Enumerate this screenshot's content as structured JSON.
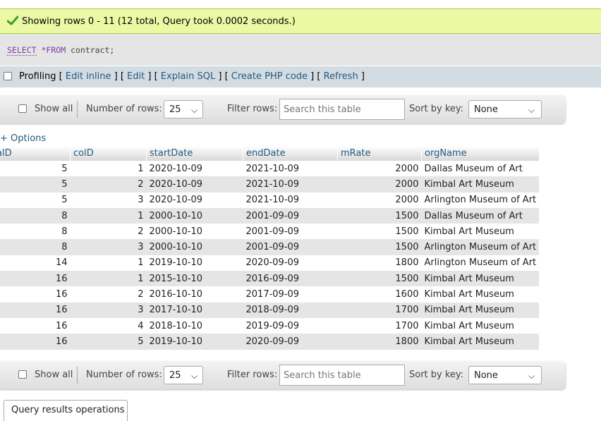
{
  "status": {
    "message": "Showing rows 0 - 11 (12 total, Query took 0.0002 seconds.)",
    "color": "#ebf8a4"
  },
  "sql": {
    "keyword1": "SELECT",
    "star": "*",
    "keyword2": "FROM",
    "rest": " contract;"
  },
  "profiling": {
    "label": "Profiling",
    "links": [
      "Edit inline",
      "Edit",
      "Explain SQL",
      "Create PHP code",
      "Refresh"
    ]
  },
  "nav": {
    "show_all": "Show all",
    "number_of_rows_label": "Number of rows:",
    "number_of_rows_value": "25",
    "filter_label": "Filter rows:",
    "filter_placeholder": "Search this table",
    "sort_label": "Sort by key:",
    "sort_value": "None"
  },
  "options_link": "+ Options",
  "table": {
    "headers": [
      "alD",
      "colD",
      "startDate",
      "endDate",
      "mRate",
      "orgName"
    ],
    "rows": [
      [
        "5",
        "1",
        "2020-10-09",
        "2021-10-09",
        "2000",
        "Dallas Museum of Art"
      ],
      [
        "5",
        "2",
        "2020-10-09",
        "2021-10-09",
        "2000",
        "Kimbal Art Museum"
      ],
      [
        "5",
        "3",
        "2020-10-09",
        "2021-10-09",
        "2000",
        "Arlington Museum of Art"
      ],
      [
        "8",
        "1",
        "2000-10-10",
        "2001-09-09",
        "1500",
        "Dallas Museum of Art"
      ],
      [
        "8",
        "2",
        "2000-10-10",
        "2001-09-09",
        "1500",
        "Kimbal Art Museum"
      ],
      [
        "8",
        "3",
        "2000-10-10",
        "2001-09-09",
        "1500",
        "Arlington Museum of Art"
      ],
      [
        "14",
        "1",
        "2019-10-10",
        "2020-09-09",
        "1800",
        "Arlington Museum of Art"
      ],
      [
        "16",
        "1",
        "2015-10-10",
        "2016-09-09",
        "1500",
        "Kimbal Art Museum"
      ],
      [
        "16",
        "2",
        "2016-10-10",
        "2017-09-09",
        "1600",
        "Kimbal Art Museum"
      ],
      [
        "16",
        "3",
        "2017-10-10",
        "2018-09-09",
        "1700",
        "Kimbal Art Museum"
      ],
      [
        "16",
        "4",
        "2018-10-10",
        "2019-09-09",
        "1700",
        "Kimbal Art Museum"
      ],
      [
        "16",
        "5",
        "2019-10-10",
        "2020-09-09",
        "1800",
        "Kimbal Art Museum"
      ]
    ]
  },
  "query_results_operations": "Query results operations"
}
